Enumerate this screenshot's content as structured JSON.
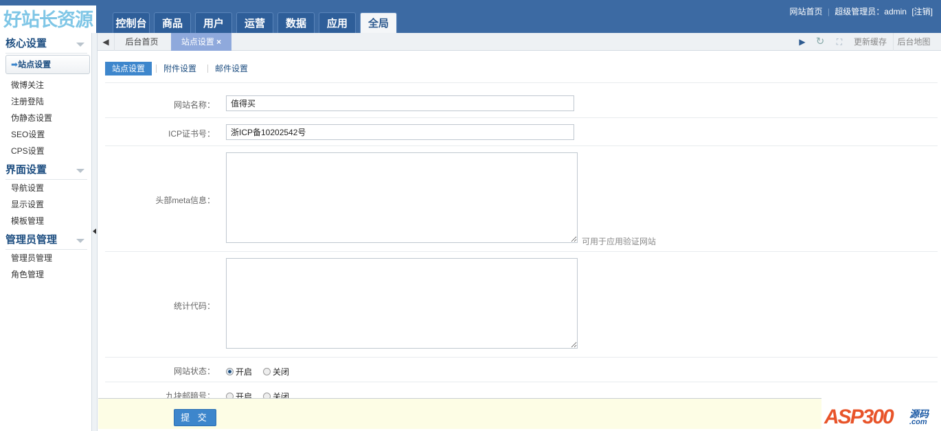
{
  "header": {
    "logo": "好站长资源",
    "nav": [
      "控制台",
      "商品",
      "用户",
      "运营",
      "数据",
      "应用",
      "全局"
    ],
    "active_nav": 6,
    "links": {
      "home": "网站首页",
      "role": "超级管理员：admin",
      "logout": "[注销]"
    }
  },
  "sidebar": {
    "groups": [
      {
        "title": "核心设置",
        "items": [
          "站点设置",
          "微博关注",
          "注册登陆",
          "伪静态设置",
          "SEO设置",
          "CPS设置"
        ]
      },
      {
        "title": "界面设置",
        "items": [
          "导航设置",
          "显示设置",
          "模板管理"
        ]
      },
      {
        "title": "管理员管理",
        "items": [
          "管理员管理",
          "角色管理"
        ]
      }
    ]
  },
  "tabs": {
    "home": "后台首页",
    "current": "站点设置",
    "refresh_cache": "更新缓存",
    "sitemap": "后台地图"
  },
  "subtabs": [
    "站点设置",
    "附件设置",
    "邮件设置"
  ],
  "form": {
    "site_name": {
      "label": "网站名称：",
      "value": "值得买"
    },
    "icp": {
      "label": "ICP证书号：",
      "value": "浙ICP备10202542号"
    },
    "meta": {
      "label": "头部meta信息：",
      "value": "",
      "hint": "可用于应用验证网站"
    },
    "stats": {
      "label": "统计代码：",
      "value": ""
    },
    "status": {
      "label": "网站状态：",
      "options": [
        "开启",
        "关闭"
      ],
      "selected": 0
    },
    "jiukuai": {
      "label": "九块邮暗号：",
      "options": [
        "开启",
        "关闭"
      ],
      "selected": null
    },
    "submit": "提 交"
  },
  "watermark": {
    "text": "ASP300",
    "cn": "源码",
    "suffix": ".com"
  }
}
